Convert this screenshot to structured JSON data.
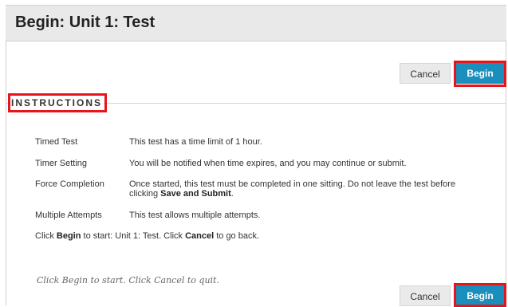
{
  "page": {
    "title": "Begin: Unit 1: Test"
  },
  "actions": {
    "cancel_label": "Cancel",
    "begin_label": "Begin"
  },
  "instructions": {
    "heading": "INSTRUCTIONS",
    "rows": [
      {
        "label": "Timed Test",
        "value": "This test has a time limit of 1 hour."
      },
      {
        "label": "Timer Setting",
        "value": "You will be notified when time expires, and you may continue or submit."
      },
      {
        "label": "Force Completion",
        "value_line1": "Once started, this test must be completed in one sitting. Do not leave the test before",
        "value_line2_prefix": "clicking ",
        "value_line2_bold": "Save and Submit",
        "value_line2_suffix": "."
      },
      {
        "label": "Multiple Attempts",
        "value": "This test allows multiple attempts."
      }
    ],
    "click_prompt": {
      "part1": "Click ",
      "bold1": "Begin",
      "part2": " to start: Unit 1: Test. Click ",
      "bold2": "Cancel",
      "part3": " to go back."
    }
  },
  "footer": {
    "note": "Click Begin to start. Click Cancel to quit."
  },
  "colors": {
    "accent": "#1a8fbd",
    "highlight": "#e8141b"
  }
}
